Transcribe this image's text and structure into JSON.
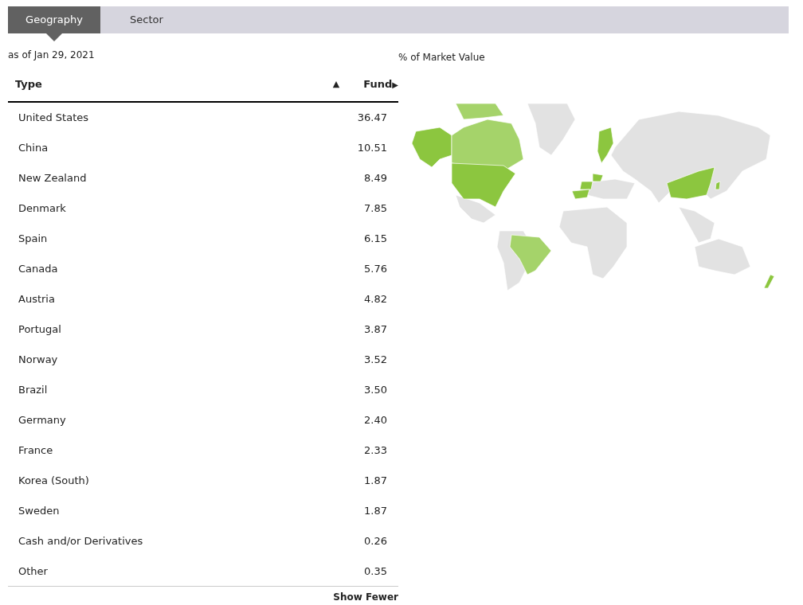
{
  "tabs": [
    {
      "label": "Geography",
      "selected": true
    },
    {
      "label": "Sector",
      "selected": false
    }
  ],
  "as_of": "as of Jan 29, 2021",
  "map_title": "% of Market Value",
  "table": {
    "columns": [
      {
        "label": "Type",
        "sort_icon": "▲"
      },
      {
        "label": "Fund",
        "sort_icon": "▶"
      }
    ],
    "rows": [
      {
        "type": "United States",
        "fund": "36.47"
      },
      {
        "type": "China",
        "fund": "10.51"
      },
      {
        "type": "New Zealand",
        "fund": "8.49"
      },
      {
        "type": "Denmark",
        "fund": "7.85"
      },
      {
        "type": "Spain",
        "fund": "6.15"
      },
      {
        "type": "Canada",
        "fund": "5.76"
      },
      {
        "type": "Austria",
        "fund": "4.82"
      },
      {
        "type": "Portugal",
        "fund": "3.87"
      },
      {
        "type": "Norway",
        "fund": "3.52"
      },
      {
        "type": "Brazil",
        "fund": "3.50"
      },
      {
        "type": "Germany",
        "fund": "2.40"
      },
      {
        "type": "France",
        "fund": "2.33"
      },
      {
        "type": "Korea (South)",
        "fund": "1.87"
      },
      {
        "type": "Sweden",
        "fund": "1.87"
      },
      {
        "type": "Cash and/or Derivatives",
        "fund": "0.26"
      },
      {
        "type": "Other",
        "fund": "0.35"
      }
    ]
  },
  "show_fewer": "Show Fewer"
}
